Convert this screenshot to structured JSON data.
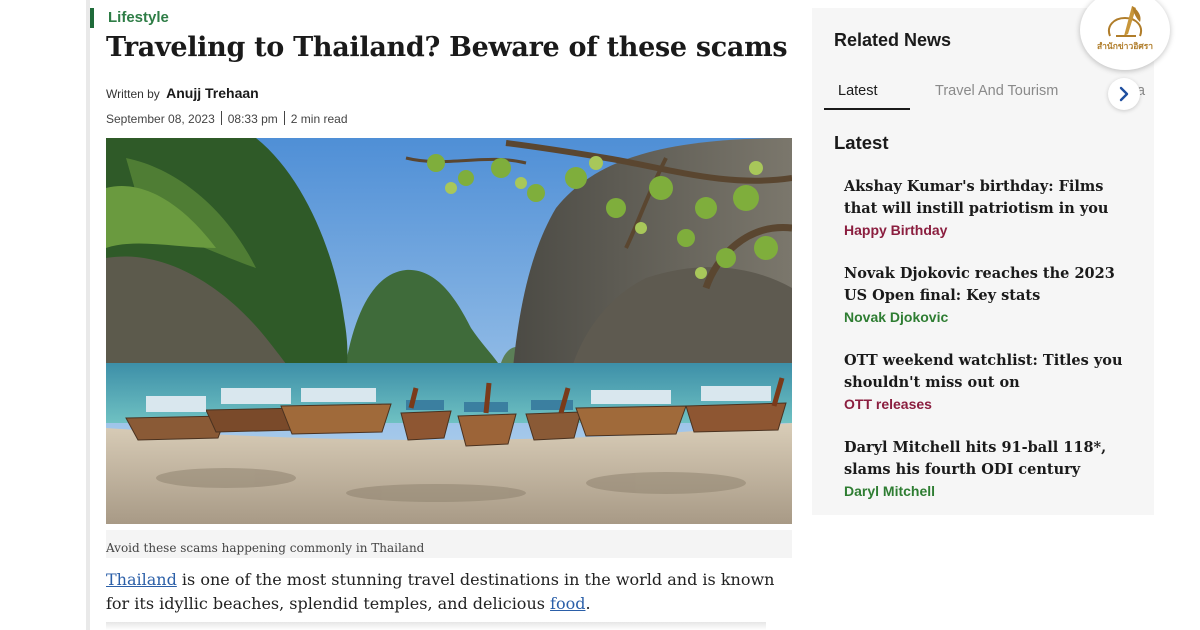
{
  "article": {
    "category": "Lifestyle",
    "headline": "Traveling to Thailand? Beware of these scams",
    "written_by_label": "Written by",
    "author": "Anujj Trehaan",
    "date": "September 08, 2023",
    "time": "08:33 pm",
    "read_time": "2 min read",
    "image_caption": "Avoid these scams happening commonly in Thailand",
    "body": {
      "link_thailand": "Thailand",
      "text_1": " is one of the most stunning travel destinations in the world and is known for its idyllic beaches, splendid temples, and delicious ",
      "link_food": "food",
      "text_2": "."
    }
  },
  "sidebar": {
    "title": "Related News",
    "tabs": [
      {
        "label": "Latest",
        "active": true
      },
      {
        "label": "Travel And Tourism",
        "active": false
      },
      {
        "label": "a",
        "active": false
      }
    ],
    "section_heading": "Latest",
    "items": [
      {
        "title": "Akshay Kumar's birthday: Films that will instill patriotism in you",
        "tag": "Happy Birthday",
        "tag_color": "#8b1e3f"
      },
      {
        "title": "Novak Djokovic reaches the 2023 US Open final: Key stats",
        "tag": "Novak Djokovic",
        "tag_color": "#2e7d32"
      },
      {
        "title": "OTT weekend watchlist: Titles you shouldn't miss out on",
        "tag": "OTT releases",
        "tag_color": "#8b1e3f"
      },
      {
        "title": "Daryl Mitchell hits 91-ball 118*, slams his fourth ODI century",
        "tag": "Daryl Mitchell",
        "tag_color": "#2e7d32"
      }
    ]
  },
  "logo": {
    "text": "สำนักข่าวอิศรา",
    "icon": "quill-pen-icon",
    "color": "#b07d2a"
  },
  "colors": {
    "category_accent": "#2e7d46",
    "link": "#2b5fa8"
  }
}
